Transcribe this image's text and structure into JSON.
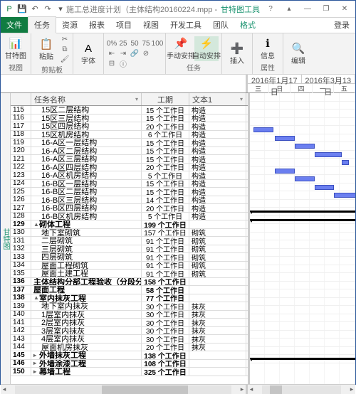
{
  "titlebar": {
    "title": "施工总进度计划（主体结构20160224.mpp - Proj...",
    "context": "甘特图工具"
  },
  "win": {
    "help": "?",
    "min": "—",
    "rest": "❐",
    "close": "✕",
    "up": "▴"
  },
  "tabs": {
    "file": "文件",
    "items": [
      "任务",
      "资源",
      "报表",
      "项目",
      "视图",
      "开发工具",
      "团队"
    ],
    "ctx": "格式",
    "login": "登录"
  },
  "ribbon": {
    "view": {
      "btn": "甘特图",
      "label": "视图"
    },
    "clip": {
      "btn": "粘贴",
      "label": "剪贴板"
    },
    "font": {
      "btn": "字体",
      "label": ""
    },
    "sched": {
      "manual": "手动安排",
      "auto": "自动安排",
      "label": "任务"
    },
    "insert": {
      "btn": "插入"
    },
    "info": {
      "btn": "信息",
      "label": "属性"
    },
    "edit": {
      "btn": "编辑"
    }
  },
  "timeline": {
    "d1": "2016年1月17日",
    "d2": "2016年3月13日",
    "days": [
      "三",
      "日",
      "四",
      "一",
      "五"
    ]
  },
  "cols": {
    "name": "任务名称",
    "dur": "工期",
    "text": "文本1"
  },
  "side": "甘特图",
  "rows": [
    {
      "id": "115",
      "name": "15区二层结构",
      "dur": "15 个工作日",
      "txt": "构造",
      "ind": 1
    },
    {
      "id": "116",
      "name": "15区三层结构",
      "dur": "15 个工作日",
      "txt": "构造",
      "ind": 1
    },
    {
      "id": "117",
      "name": "15区四层结构",
      "dur": "20 个工作日",
      "txt": "构造",
      "ind": 1
    },
    {
      "id": "118",
      "name": "15区机房结构",
      "dur": "6 个工作日",
      "txt": "构造",
      "ind": 1
    },
    {
      "id": "119",
      "name": "16-A区一层结构",
      "dur": "15 个工作日",
      "txt": "构造",
      "ind": 1,
      "bar": [
        5,
        28
      ]
    },
    {
      "id": "120",
      "name": "16-A区二层结构",
      "dur": "15 个工作日",
      "txt": "构造",
      "ind": 1,
      "bar": [
        35,
        28
      ]
    },
    {
      "id": "121",
      "name": "16-A区三层结构",
      "dur": "15 个工作日",
      "txt": "构造",
      "ind": 1,
      "bar": [
        63,
        28
      ]
    },
    {
      "id": "122",
      "name": "16-A区四层结构",
      "dur": "20 个工作日",
      "txt": "构造",
      "ind": 1,
      "bar": [
        91,
        38
      ]
    },
    {
      "id": "123",
      "name": "16-A区机房结构",
      "dur": "5 个工作日",
      "txt": "构造",
      "ind": 1,
      "bar": [
        129,
        10
      ]
    },
    {
      "id": "124",
      "name": "16-B区一层结构",
      "dur": "15 个工作日",
      "txt": "构造",
      "ind": 1,
      "bar": [
        35,
        28
      ]
    },
    {
      "id": "125",
      "name": "16-B区二层结构",
      "dur": "15 个工作日",
      "txt": "构造",
      "ind": 1,
      "bar": [
        63,
        28
      ]
    },
    {
      "id": "126",
      "name": "16-B区三层结构",
      "dur": "14 个工作日",
      "txt": "构造",
      "ind": 1,
      "bar": [
        91,
        27
      ]
    },
    {
      "id": "127",
      "name": "16-B区四层结构",
      "dur": "20 个工作日",
      "txt": "构造",
      "ind": 1,
      "bar": [
        118,
        38
      ]
    },
    {
      "id": "128",
      "name": "16-B区机房结构",
      "dur": "5 个工作日",
      "txt": "构造",
      "ind": 1
    },
    {
      "id": "129",
      "name": "砌体工程",
      "dur": "199 个工作日",
      "txt": "",
      "bold": 1,
      "exp": "▲",
      "sum": [
        2,
        150
      ]
    },
    {
      "id": "130",
      "name": "地下室砌筑",
      "dur": "157 个工作日",
      "txt": "砌筑",
      "ind": 1,
      "sum": [
        2,
        150
      ]
    },
    {
      "id": "131",
      "name": "二层砌筑",
      "dur": "91 个工作日",
      "txt": "砌筑",
      "ind": 1
    },
    {
      "id": "132",
      "name": "三层砌筑",
      "dur": "91 个工作日",
      "txt": "砌筑",
      "ind": 1
    },
    {
      "id": "133",
      "name": "四层砌筑",
      "dur": "91 个工作日",
      "txt": "砌筑",
      "ind": 1
    },
    {
      "id": "134",
      "name": "屋面工程砌筑",
      "dur": "91 个工作日",
      "txt": "砌筑",
      "ind": 1
    },
    {
      "id": "135",
      "name": "屋面土建工程",
      "dur": "91 个工作日",
      "txt": "砌筑",
      "ind": 1
    },
    {
      "id": "136",
      "name": "主体结构分部工程验收（分段分层）",
      "dur": "158 个工作日",
      "txt": "",
      "bold": 1
    },
    {
      "id": "137",
      "name": "屋面工程",
      "dur": "58 个工作日",
      "txt": "",
      "bold": 1
    },
    {
      "id": "138",
      "name": "室内抹灰工程",
      "dur": "77 个工作日",
      "txt": "",
      "bold": 1,
      "exp": "▲"
    },
    {
      "id": "139",
      "name": "地下室内抹灰",
      "dur": "30 个工作日",
      "txt": "抹灰",
      "ind": 1
    },
    {
      "id": "140",
      "name": "1层室内抹灰",
      "dur": "30 个工作日",
      "txt": "抹灰",
      "ind": 1
    },
    {
      "id": "141",
      "name": "2层室内抹灰",
      "dur": "30 个工作日",
      "txt": "抹灰",
      "ind": 1
    },
    {
      "id": "142",
      "name": "3层室内抹灰",
      "dur": "30 个工作日",
      "txt": "抹灰",
      "ind": 1
    },
    {
      "id": "143",
      "name": "4层室内抹灰",
      "dur": "30 个工作日",
      "txt": "抹灰",
      "ind": 1
    },
    {
      "id": "144",
      "name": "屋面机房抹灰",
      "dur": "20 个工作日",
      "txt": "抹灰",
      "ind": 1
    },
    {
      "id": "145",
      "name": "外墙抹灰工程",
      "dur": "138 个工作日",
      "txt": "",
      "bold": 1,
      "exp": "▸"
    },
    {
      "id": "146",
      "name": "外墙涂漆工程",
      "dur": "108 个工作日",
      "txt": "",
      "bold": 1,
      "exp": "▸"
    },
    {
      "id": "150",
      "name": "幕墙工程",
      "dur": "325 个工作日",
      "txt": "",
      "bold": 1,
      "exp": "▸",
      "sum": [
        2,
        150
      ]
    }
  ]
}
